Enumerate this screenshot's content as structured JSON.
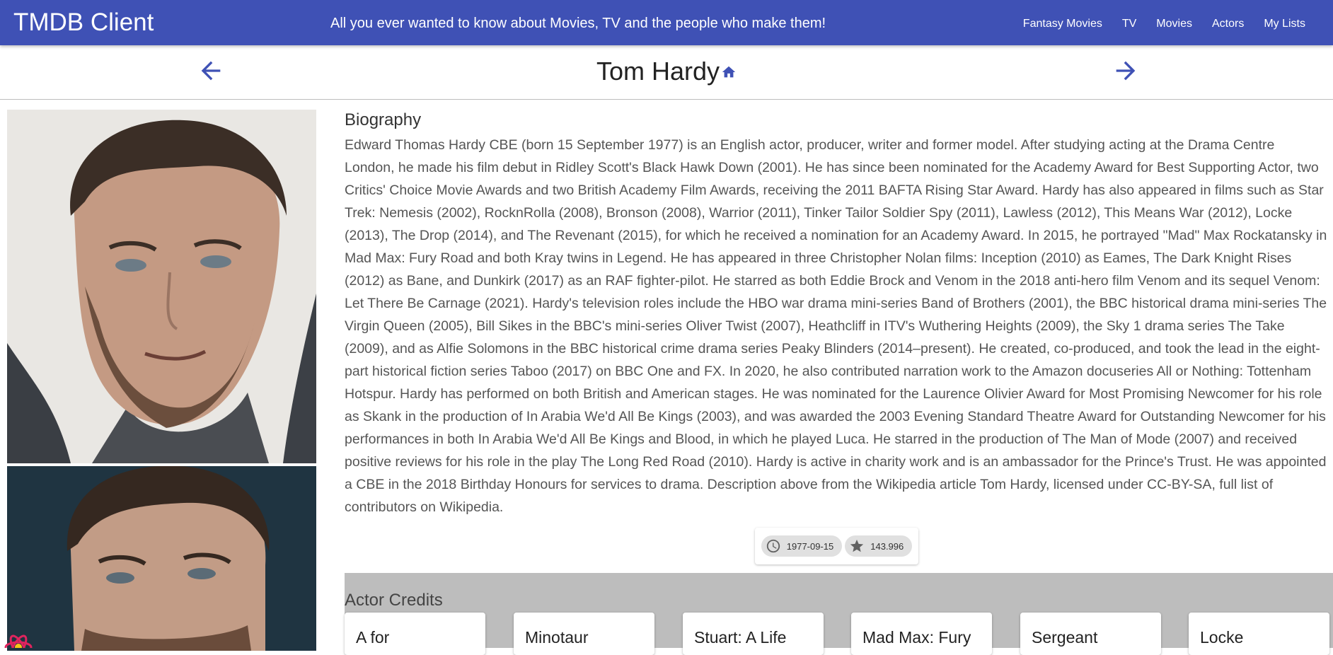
{
  "app": {
    "brand": "TMDB Client",
    "tagline": "All you ever wanted to know about Movies, TV and the people who make them!",
    "nav": [
      "Fantasy Movies",
      "TV",
      "Movies",
      "Actors",
      "My Lists"
    ]
  },
  "header": {
    "name": "Tom Hardy"
  },
  "bio": {
    "heading": "Biography",
    "text": "Edward Thomas Hardy CBE (born 15 September 1977) is an English actor, producer, writer and former model. After studying acting at the Drama Centre London, he made his film debut in Ridley Scott's Black Hawk Down (2001). He has since been nominated for the Academy Award for Best Supporting Actor, two Critics' Choice Movie Awards and two British Academy Film Awards, receiving the 2011 BAFTA Rising Star Award. Hardy has also appeared in films such as Star Trek: Nemesis (2002), RocknRolla (2008), Bronson (2008), Warrior (2011), Tinker Tailor Soldier Spy (2011), Lawless (2012), This Means War (2012), Locke (2013), The Drop (2014), and The Revenant (2015), for which he received a nomination for an Academy Award. In 2015, he portrayed \"Mad\" Max Rockatansky in Mad Max: Fury Road and both Kray twins in Legend. He has appeared in three Christopher Nolan films: Inception (2010) as Eames, The Dark Knight Rises (2012) as Bane, and Dunkirk (2017) as an RAF fighter-pilot. He starred as both Eddie Brock and Venom in the 2018 anti-hero film Venom and its sequel Venom: Let There Be Carnage (2021). Hardy's television roles include the HBO war drama mini-series Band of Brothers (2001), the BBC historical drama mini-series The Virgin Queen (2005), Bill Sikes in the BBC's mini-series Oliver Twist (2007), Heathcliff in ITV's Wuthering Heights (2009), the Sky 1 drama series The Take (2009), and as Alfie Solomons in the BBC historical crime drama series Peaky Blinders (2014–present). He created, co-produced, and took the lead in the eight-part historical fiction series Taboo (2017) on BBC One and FX. In 2020, he also contributed narration work to the Amazon docuseries All or Nothing: Tottenham Hotspur. Hardy has performed on both British and American stages. He was nominated for the Laurence Olivier Award for Most Promising Newcomer for his role as Skank in the production of In Arabia We'd All Be Kings (2003), and was awarded the 2003 Evening Standard Theatre Award for Outstanding Newcomer for his performances in both In Arabia We'd All Be Kings and Blood, in which he played Luca. He starred in the production of The Man of Mode (2007) and received positive reviews for his role in the play The Long Red Road (2010). Hardy is active in charity work and is an ambassador for the Prince's Trust. He was appointed a CBE in the 2018 Birthday Honours for services to drama. Description above from the Wikipedia article Tom Hardy, licensed under CC-BY-SA, full list of contributors on Wikipedia."
  },
  "chips": {
    "birthday": "1977-09-15",
    "popularity": "143.996"
  },
  "credits": {
    "heading": "Actor Credits",
    "items": [
      "A for",
      "Minotaur",
      "Stuart: A Life",
      "Mad Max: Fury",
      "Sergeant",
      "Locke"
    ]
  },
  "icons": {
    "prev": "arrow-back-icon",
    "next": "arrow-forward-icon",
    "home": "home-icon",
    "birthday": "clock-icon",
    "popularity": "star-icon"
  },
  "colors": {
    "primary": "#3f51b5",
    "credits_bg": "#bdbdbd",
    "chip_bg": "#e0e0e0"
  }
}
